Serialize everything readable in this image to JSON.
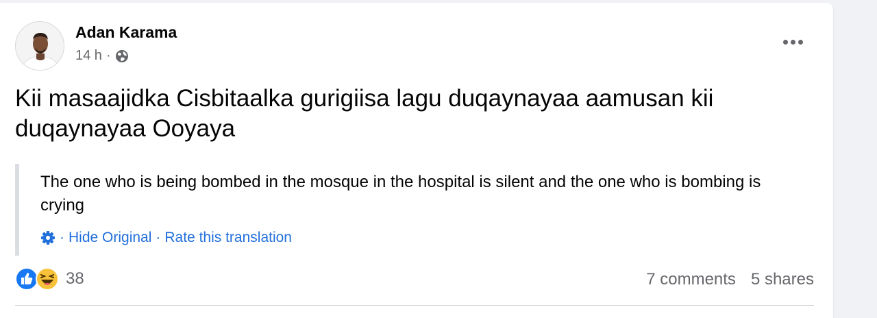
{
  "post": {
    "author": "Adan Karama",
    "time": "14 h",
    "separator": "·",
    "privacy_icon": "globe-icon",
    "more_icon": "more-options-icon",
    "text": "Kii masaajidka Cisbitaalka gurigiisa lagu duqaynayaa aamusan kii duqaynayaa Ooyaya"
  },
  "translation": {
    "text": "The one who is being bombed in the mosque in the hospital is silent and the one who is bombing is crying",
    "settings_icon": "gear-icon",
    "dot": "·",
    "hide_original": "Hide Original",
    "rate_translation": "Rate this translation"
  },
  "reactions": {
    "icons": [
      "like-icon",
      "haha-icon"
    ],
    "count": "38",
    "comments": "7 comments",
    "shares": "5 shares"
  },
  "colors": {
    "link": "#216fdb",
    "secondary_text": "#65676b",
    "like_blue": "#1877f2",
    "haha_yellow": "#f7c23a"
  }
}
